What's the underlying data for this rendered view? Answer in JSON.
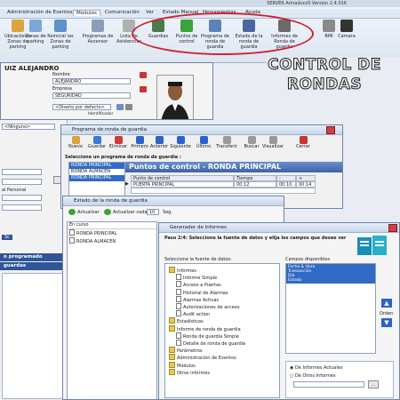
{
  "app_title": "SERVER Arinaducs5 Version 2.4.016",
  "menu": [
    "Administración de Eventos",
    "Módulos",
    "Comunicación",
    "Ver",
    "Estado Manual",
    "Herramientas",
    "Ayuda"
  ],
  "toolbar": [
    {
      "label": "Ubicaciones Zonas de parking",
      "color": "#d9a441"
    },
    {
      "label": "Zonas de parking",
      "color": "#7da7d9"
    },
    {
      "label": "Reinicial las Zonas de parking",
      "color": "#5c93c8"
    },
    {
      "label": "Programas de Ascensor",
      "color": "#8a9fb5"
    },
    {
      "label": "Lista de Asistencias",
      "color": "#b0b0b0"
    },
    {
      "label": "Guardias",
      "color": "#4c7a4c"
    },
    {
      "label": "Puntos de control",
      "color": "#3aa33a"
    },
    {
      "label": "Programa de ronda de guardia",
      "color": "#5b83b8"
    },
    {
      "label": "Estado de la ronda de guardia",
      "color": "#4a66a0"
    },
    {
      "label": "Informes de Ronda de guardia",
      "color": "#6b6b6b"
    },
    {
      "label": "BMI",
      "color": "#8a8a8a"
    },
    {
      "label": "Cámara",
      "color": "#333333"
    }
  ],
  "overlay_text": {
    "line1": "CONTROL DE",
    "line2": "RONDAS"
  },
  "person_form": {
    "name_header": "UIZ ALEJANDRO",
    "nombre_label": "Nombre",
    "nombre_value": "ALEJANDRO",
    "empresa_label": "Empresa",
    "empresa_value": "SEGURIDAD",
    "design_select": "<Diseño por defecto>",
    "identificador": "Identificador"
  },
  "left_panel": {
    "ninguno": "<Ninguno>",
    "personal": "al Personal",
    "programado": "o programado",
    "agentes": "guardas",
    "sc": "Sc"
  },
  "ronda_window": {
    "title": "Programa de ronda de guardia",
    "tools": [
      "Nuevo",
      "Guardar",
      "Eliminar",
      "Primero",
      "Anterior",
      "Siguiente",
      "Último",
      "Transferir",
      "Buscar",
      "Visualizar",
      "Cerrar"
    ],
    "select_label": "Seleccione un programa de ronda de guardia :",
    "list": [
      "RONDA PRINCIPAL",
      "RONDA ALMACEN",
      "RONDA PRINCIPAL"
    ],
    "header": "Puntos de control - RONDA PRINCIPAL",
    "columns": [
      "Punto de control",
      "Tiempo",
      "-",
      "+"
    ],
    "row": {
      "punto": "PUERTA PRINCIPAL",
      "tiempo": "00:12",
      "minus": "00:10",
      "plus": "00:14"
    }
  },
  "estado_window": {
    "title": "Estado de la ronda de guardia",
    "refresh": "Actualizar",
    "refresh_every": "Actualizar cada",
    "interval": "10",
    "unit": "Seg.",
    "col_header": "En curso",
    "items": [
      "RONDA PRINCIPAL",
      "RONDA ALMACEN"
    ]
  },
  "report_window": {
    "title": "Generador de Informes",
    "step": "Paso 2/4: Seleccione la fuente de datos y elija los campos que desee ver",
    "source_label": "Seleccione la fuente de datos:",
    "fields_label": "Campos disponibles",
    "tree": [
      {
        "label": "Informes",
        "type": "folder",
        "indent": 0
      },
      {
        "label": "Informe Simple",
        "type": "doc",
        "indent": 1
      },
      {
        "label": "Acceso a Puertas",
        "type": "doc",
        "indent": 1
      },
      {
        "label": "Historial de Alarmas",
        "type": "doc",
        "indent": 1
      },
      {
        "label": "Alarmas Activas",
        "type": "doc",
        "indent": 1
      },
      {
        "label": "Autorizaciones de acceso",
        "type": "doc",
        "indent": 1
      },
      {
        "label": "Audit action",
        "type": "doc",
        "indent": 1
      },
      {
        "label": "Estadísticas",
        "type": "folder",
        "indent": 0
      },
      {
        "label": "Informe de ronda de guardia",
        "type": "folder",
        "indent": 0
      },
      {
        "label": "Ronda de guardia Simple",
        "type": "doc",
        "indent": 1
      },
      {
        "label": "Detalle de ronda de guardia",
        "type": "doc",
        "indent": 1
      },
      {
        "label": "Parámetros",
        "type": "folder",
        "indent": 0
      },
      {
        "label": "Administración de Eventos",
        "type": "folder",
        "indent": 0
      },
      {
        "label": "Módulos",
        "type": "folder",
        "indent": 0
      },
      {
        "label": "Otros informes",
        "type": "folder",
        "indent": 0
      }
    ],
    "fields": [
      "Fecha & Hora",
      "Transacción",
      "Día",
      "Estado"
    ],
    "order_label": "Orden",
    "radio1": "De Informes Actuales",
    "radio2": "De Otros Informes"
  }
}
